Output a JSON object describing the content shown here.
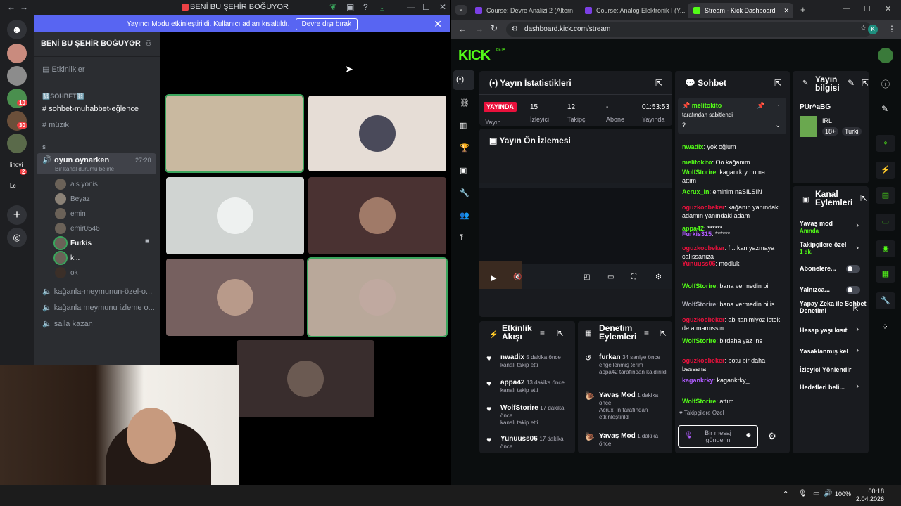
{
  "discord": {
    "window_title": "BENİ BU ŞEHİR BOĞUYOR",
    "banner_text": "Yayıncı Modu etkinleştirildi. Kullanıcı adları kısaltıldı.",
    "banner_button": "Devre dışı bırak",
    "server_name": "BENİ BU ŞEHİR BOĞUYOR",
    "events_label": "Etkinlikler",
    "category_1": "🔢SOHBET🔢",
    "channels": [
      "sohbet-muhabbet-eğlence",
      "müzik"
    ],
    "category_2": "s",
    "voice_channel": "oyun oynarken",
    "voice_timer": "27:20",
    "voice_status": "Bir kanal durumu belirle",
    "voice_users": [
      "ais yonis",
      "Beyaz",
      "emin",
      "emir0546",
      "Furkis",
      "k...",
      "ok"
    ],
    "voice_channels_2": [
      "kağanla-meymunun-özel-o...",
      "kağanla meymunu izleme o...",
      "salla kazan"
    ],
    "guild_badges": [
      "10",
      "30",
      "2"
    ],
    "guild_labels": [
      "linovi",
      "Lc"
    ]
  },
  "taskbar": {
    "time": "00:18",
    "date": "2.04.2026",
    "battery": "100%"
  },
  "browser": {
    "tabs": [
      {
        "title": "Course: Devre Analizi 2 (Altern",
        "color": "#7b3fe4"
      },
      {
        "title": "Course: Analog Elektronik I (Y...",
        "color": "#7b3fe4"
      },
      {
        "title": "Stream - Kick Dashboard",
        "color": "#53fc18"
      }
    ],
    "url": "dashboard.kick.com/stream"
  },
  "kick": {
    "logo": "KICK",
    "beta": "BETA",
    "stats": {
      "title": "Yayın İstatistikleri",
      "live_badge": "YAYINDA",
      "live_sub": "Yayın",
      "viewers": "15",
      "viewers_label": "İzleyici",
      "followers": "12",
      "followers_label": "Takipçi",
      "subs": "-",
      "subs_label": "Abone",
      "uptime": "01:53:53",
      "uptime_label": "Yayında"
    },
    "preview_title": "Yayın Ön İzlemesi",
    "activity": {
      "title": "Etkinlik Akışı",
      "items": [
        {
          "name": "nwadix",
          "time": "5 dakika önce",
          "desc": "kanalı takip etti"
        },
        {
          "name": "appa42",
          "time": "13 dakika önce",
          "desc": "kanalı takip etti"
        },
        {
          "name": "WolfStorire",
          "time": "17 dakika önce",
          "desc": "kanalı takip etti"
        },
        {
          "name": "Yunuuss06",
          "time": "17 dakika önce",
          "desc": ""
        }
      ]
    },
    "moderation": {
      "title": "Denetim Eylemleri",
      "items": [
        {
          "name": "furkan",
          "time": "34 saniye önce",
          "desc": "engellenmiş terim",
          "desc2": "appa42 tarafından kaldırıldı"
        },
        {
          "name": "Yavaş Mod",
          "time": "1 dakika önce",
          "desc": "Acrux_ln tarafından etkinleştirildi"
        },
        {
          "name": "Yavaş Mod",
          "time": "1 dakika önce",
          "desc": ""
        }
      ]
    },
    "chat": {
      "title": "Sohbet",
      "pinned_user": "melitokito",
      "pinned_text": "tarafından sabitlendi",
      "pinned_msg": "?",
      "messages": [
        {
          "user": "nwadix",
          "text": "yok oğlum",
          "color": "#53fc18"
        },
        {
          "user": "melitokito",
          "text": "Oo kağanım",
          "color": "#53fc18"
        },
        {
          "user": "WolfStorire",
          "text": "kaganrkry buma attım",
          "color": "#53fc18"
        },
        {
          "user": "Acrux_ln",
          "text": "eminim naSILSIN",
          "color": "#53fc18"
        },
        {
          "user": "oguzkocbeker",
          "text": "kağanın yanındaki adamın yanındaki adam",
          "color": "#e9113c"
        },
        {
          "user": "appa42",
          "text": "******",
          "color": "#53fc18"
        },
        {
          "user": "Furkis315",
          "text": "******",
          "color": "#b05cff"
        },
        {
          "user": "oguzkocbeker",
          "text": "f .. kan yazmaya calıssanıza",
          "color": "#e9113c"
        },
        {
          "user": "Yunuuss06",
          "text": "modluk",
          "color": "#e9113c"
        },
        {
          "user": "WolfStorire",
          "text": "bana vermedin bi",
          "color": "#53fc18"
        },
        {
          "user": "WolfStorire",
          "text": "bana vermedin bi is...",
          "color": "#adadb8"
        },
        {
          "user": "oguzkocbeker",
          "text": "abi tanimiyoz istek de atmamıssın",
          "color": "#e9113c"
        },
        {
          "user": "WolfStorire",
          "text": "birdaha yaz ins",
          "color": "#53fc18"
        },
        {
          "user": "oguzkocbeker",
          "text": "botu bir daha bassana",
          "color": "#e9113c"
        },
        {
          "user": "kagankrky",
          "text": "kagankrky_",
          "color": "#b05cff"
        },
        {
          "user": "WolfStorire",
          "text": "attım",
          "color": "#53fc18"
        }
      ],
      "followers_only": "Takipçilere Özel",
      "input_placeholder": "Bir mesaj gönderin"
    },
    "stream_info": {
      "title": "Yayın bilgisi",
      "stream_title": "PUr^aBG",
      "category": "IRL",
      "tag_age": "18+",
      "tag_lang": "Turki"
    },
    "channel_actions": {
      "title": "Kanal Eylemleri",
      "items": [
        {
          "label": "Yavaş mod",
          "sub": "Anında"
        },
        {
          "label": "Takipçilere özel",
          "sub": "1 dk."
        },
        {
          "label": "Abonelere...",
          "sub": ""
        },
        {
          "label": "Yalnızca...",
          "sub": ""
        },
        {
          "label": "Yapay Zeka ile Sohbet Denetimi",
          "sub": ""
        },
        {
          "label": "Hesap yaşı kısıt",
          "sub": ""
        },
        {
          "label": "Yasaklanmış kel",
          "sub": ""
        },
        {
          "label": "İzleyici Yönlendir",
          "sub": ""
        },
        {
          "label": "Hedefleri beli...",
          "sub": ""
        }
      ]
    }
  }
}
